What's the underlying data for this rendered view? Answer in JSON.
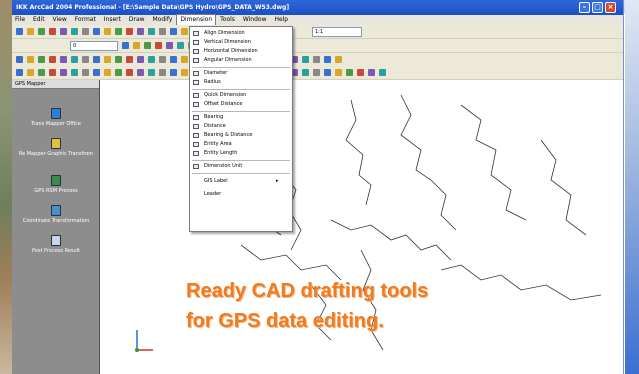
{
  "window": {
    "title": "IKK ArcCad 2004 Professional - [E:\\Sample Data\\GPS Hydro\\GPS_DATA_W53.dwg]"
  },
  "menubar": {
    "items": [
      "File",
      "Edit",
      "View",
      "Format",
      "Insert",
      "Draw",
      "Modify",
      "Dimension",
      "Tools",
      "Window",
      "Help"
    ],
    "active_index": 7
  },
  "toolbar": {
    "layer_value": "0",
    "scale_value": "1:1"
  },
  "sidebar": {
    "title": "GPS Mapper",
    "items": [
      "Trans Mapper Office",
      "Re Mapper Graphic Transfrom",
      "GPS RSM Process",
      "Coordinate Transformation",
      "Post Process Result"
    ]
  },
  "dimension_menu": {
    "items": [
      "Align Dimension",
      "Vertical Dimension",
      "Horizontal Dimension",
      "Angular Dimension",
      "Diameter",
      "Radius",
      "Quick Dimension",
      "Offset Distance",
      "Bearing",
      "Distance",
      "Bearing & Distance",
      "Entity Area",
      "Entity Length",
      "Dimension Unit",
      "GIS Label",
      "Leader"
    ]
  },
  "caption": {
    "line1": "Ready CAD drafting tools",
    "line2": "for GPS data editing."
  },
  "colors": {
    "title_bar": "#1b4fc4",
    "caption": "#f07b20",
    "sidebar": "#8d8d8d"
  }
}
